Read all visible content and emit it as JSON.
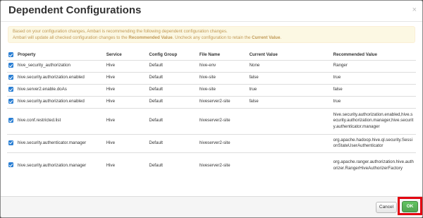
{
  "dialog": {
    "title": "Dependent Configurations",
    "close_glyph": "×"
  },
  "alert": {
    "line1": "Based on your configuration changes, Ambari is recommending the following dependent configuration changes.",
    "line2_pre": "Ambari will update all checked configuration changes to the ",
    "line2_b1": "Recommended Value",
    "line2_mid": ". Uncheck any configuration to retain the ",
    "line2_b2": "Current Value",
    "line2_post": "."
  },
  "table": {
    "headers": {
      "property": "Property",
      "service": "Service",
      "config_group": "Config Group",
      "file_name": "File Name",
      "current_value": "Current Value",
      "recommended_value": "Recommended Value"
    },
    "header_checked": true,
    "rows": [
      {
        "checked": true,
        "property": "hive_security_authorization",
        "service": "Hive",
        "config_group": "Default",
        "file_name": "hive-env",
        "current_value": "None",
        "recommended_value": "Ranger"
      },
      {
        "checked": true,
        "property": "hive.security.authorization.enabled",
        "service": "Hive",
        "config_group": "Default",
        "file_name": "hive-site",
        "current_value": "false",
        "recommended_value": "true"
      },
      {
        "checked": true,
        "property": "hive.server2.enable.doAs",
        "service": "Hive",
        "config_group": "Default",
        "file_name": "hive-site",
        "current_value": "true",
        "recommended_value": "false"
      },
      {
        "checked": true,
        "property": "hive.security.authorization.enabled",
        "service": "Hive",
        "config_group": "Default",
        "file_name": "hiveserver2-site",
        "current_value": "false",
        "recommended_value": "true"
      },
      {
        "checked": true,
        "property": "hive.conf.restricted.list",
        "service": "Hive",
        "config_group": "Default",
        "file_name": "hiveserver2-site",
        "current_value": "",
        "recommended_value": "hive.security.authorization.enabled,hive.security.authorization.manager,hive.security.authenticator.manager"
      },
      {
        "checked": true,
        "property": "hive.security.authenticator.manager",
        "service": "Hive",
        "config_group": "Default",
        "file_name": "hiveserver2-site",
        "current_value": "",
        "recommended_value": "org.apache.hadoop.hive.ql.security.SessionStateUserAuthenticator"
      },
      {
        "checked": true,
        "property": "hive.security.authorization.manager",
        "service": "Hive",
        "config_group": "Default",
        "file_name": "hiveserver2-site",
        "current_value": "",
        "recommended_value": "org.apache.ranger.authorization.hive.authorizer.RangerHiveAuthorizerFactory"
      }
    ]
  },
  "footer": {
    "cancel_label": "Cancel",
    "ok_label": "OK",
    "highlight_color": "#e3000f"
  }
}
